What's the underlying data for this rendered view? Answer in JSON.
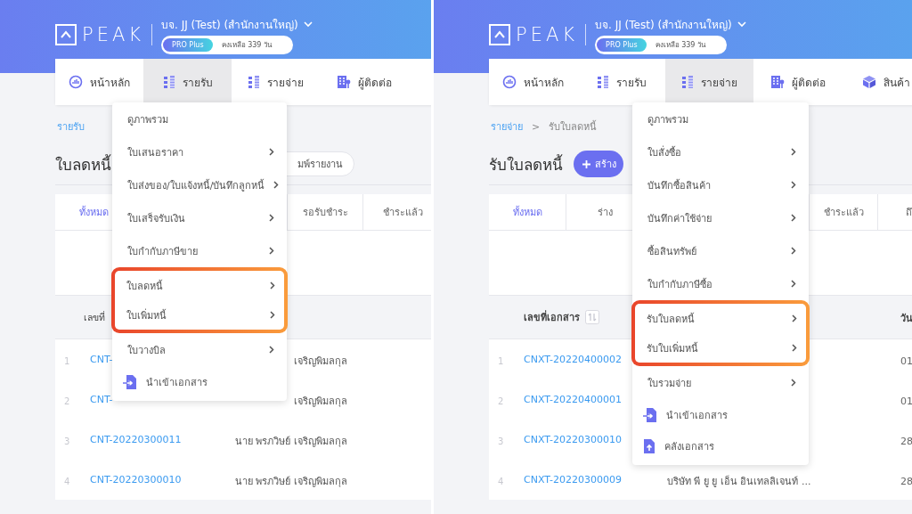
{
  "panels": [
    {
      "logo_text": "PEAK",
      "company": "บจ. JJ (Test) (สำนักงานใหญ่)",
      "plan": "PRO Plus",
      "remaining": "คงเหลือ 339 วัน",
      "nav": [
        {
          "label": "หน้าหลัก",
          "selected": false
        },
        {
          "label": "รายรับ",
          "selected": true
        },
        {
          "label": "รายจ่าย",
          "selected": false
        },
        {
          "label": "ผู้ติดต่อ",
          "selected": false
        }
      ],
      "breadcrumb": [
        {
          "label": "รายรับ",
          "kind": "link"
        }
      ],
      "title": "ใบลดหนี้",
      "report_button": "มพ์รายงาน",
      "tabs": [
        {
          "label": "ทั้งหมด",
          "selected": true
        },
        {
          "label": "รอรับชำระ",
          "selected": false
        },
        {
          "label": "ชำระแล้ว",
          "selected": false
        }
      ],
      "table": {
        "doc_header": "เลขที่",
        "rows": [
          {
            "index": "1",
            "doc_no": "CNT-",
            "contact": "เจริญพิมลกุล"
          },
          {
            "index": "2",
            "doc_no": "CNT-",
            "contact": "เจริญพิมลกุล"
          },
          {
            "index": "3",
            "doc_no": "CNT-20220300011",
            "contact": "นาย พรภวิษย์ เจริญพิมลกุล"
          },
          {
            "index": "4",
            "doc_no": "CNT-20220300010",
            "contact": "นาย พรภวิษย์ เจริญพิมลกุล"
          }
        ]
      },
      "menu": [
        {
          "label": "ดูภาพรวม",
          "kind": "plain",
          "highlighted": false
        },
        {
          "label": "ใบเสนอราคา",
          "kind": "submenu",
          "highlighted": false
        },
        {
          "label": "ใบส่งของ/ใบแจ้งหนี้/บันทึกลูกหนี้",
          "kind": "submenu",
          "highlighted": false
        },
        {
          "label": "ใบเสร็จรับเงิน",
          "kind": "submenu",
          "highlighted": false
        },
        {
          "label": "ใบกำกับภาษีขาย",
          "kind": "submenu",
          "highlighted": false
        },
        {
          "label": "ใบลดหนี้",
          "kind": "submenu",
          "highlighted": true
        },
        {
          "label": "ใบเพิ่มหนี้",
          "kind": "submenu",
          "highlighted": true
        },
        {
          "label": "ใบวางบิล",
          "kind": "submenu",
          "highlighted": false
        },
        {
          "label": "นำเข้าเอกสาร",
          "kind": "import",
          "highlighted": false
        }
      ]
    },
    {
      "logo_text": "PEAK",
      "company": "บจ. JJ (Test) (สำนักงานใหญ่)",
      "plan": "PRO Plus",
      "remaining": "คงเหลือ 339 วัน",
      "nav": [
        {
          "label": "หน้าหลัก",
          "selected": false
        },
        {
          "label": "รายรับ",
          "selected": false
        },
        {
          "label": "รายจ่าย",
          "selected": true
        },
        {
          "label": "ผู้ติดต่อ",
          "selected": false
        },
        {
          "label": "สินค้า",
          "selected": false
        }
      ],
      "breadcrumb": [
        {
          "label": "รายจ่าย",
          "kind": "link"
        },
        {
          "label": ">",
          "kind": "separator"
        },
        {
          "label": "รับใบลดหนี้",
          "kind": "current"
        }
      ],
      "title": "รับใบลดหนี้",
      "create_button": "สร้าง",
      "tabs": [
        {
          "label": "ทั้งหมด",
          "selected": true
        },
        {
          "label": "ร่าง",
          "selected": false
        },
        {
          "label": "ชำระแล้ว",
          "selected": false
        },
        {
          "label": "ถึ",
          "selected": false
        }
      ],
      "table": {
        "doc_header": "เลขที่เอกสาร",
        "doc_sortable": true,
        "date_header": "วัน",
        "rows": [
          {
            "index": "1",
            "doc_no": "CNXT-20220400002",
            "date": "01"
          },
          {
            "index": "2",
            "doc_no": "CNXT-20220400001",
            "date": "01"
          },
          {
            "index": "3",
            "doc_no": "CNXT-20220300010",
            "date": "28"
          },
          {
            "index": "4",
            "doc_no": "CNXT-20220300009",
            "contact": "บริษัท พี ยู ยู เอ็น อินเทลลิเจนท์ ...",
            "date": "28"
          }
        ]
      },
      "menu": [
        {
          "label": "ดูภาพรวม",
          "kind": "plain",
          "highlighted": false
        },
        {
          "label": "ใบสั่งซื้อ",
          "kind": "submenu",
          "highlighted": false
        },
        {
          "label": "บันทึกซื้อสินค้า",
          "kind": "submenu",
          "highlighted": false
        },
        {
          "label": "บันทึกค่าใช้จ่าย",
          "kind": "submenu",
          "highlighted": false
        },
        {
          "label": "ซื้อสินทรัพย์",
          "kind": "submenu",
          "highlighted": false
        },
        {
          "label": "ใบกำกับภาษีซื้อ",
          "kind": "submenu",
          "highlighted": false
        },
        {
          "label": "รับใบลดหนี้",
          "kind": "submenu",
          "highlighted": true
        },
        {
          "label": "รับใบเพิ่มหนี้",
          "kind": "submenu",
          "highlighted": true
        },
        {
          "label": "ใบรวมจ่าย",
          "kind": "submenu",
          "highlighted": false
        },
        {
          "label": "นำเข้าเอกสาร",
          "kind": "import",
          "highlighted": false
        },
        {
          "label": "คลังเอกสาร",
          "kind": "storage",
          "highlighted": false
        }
      ]
    }
  ]
}
